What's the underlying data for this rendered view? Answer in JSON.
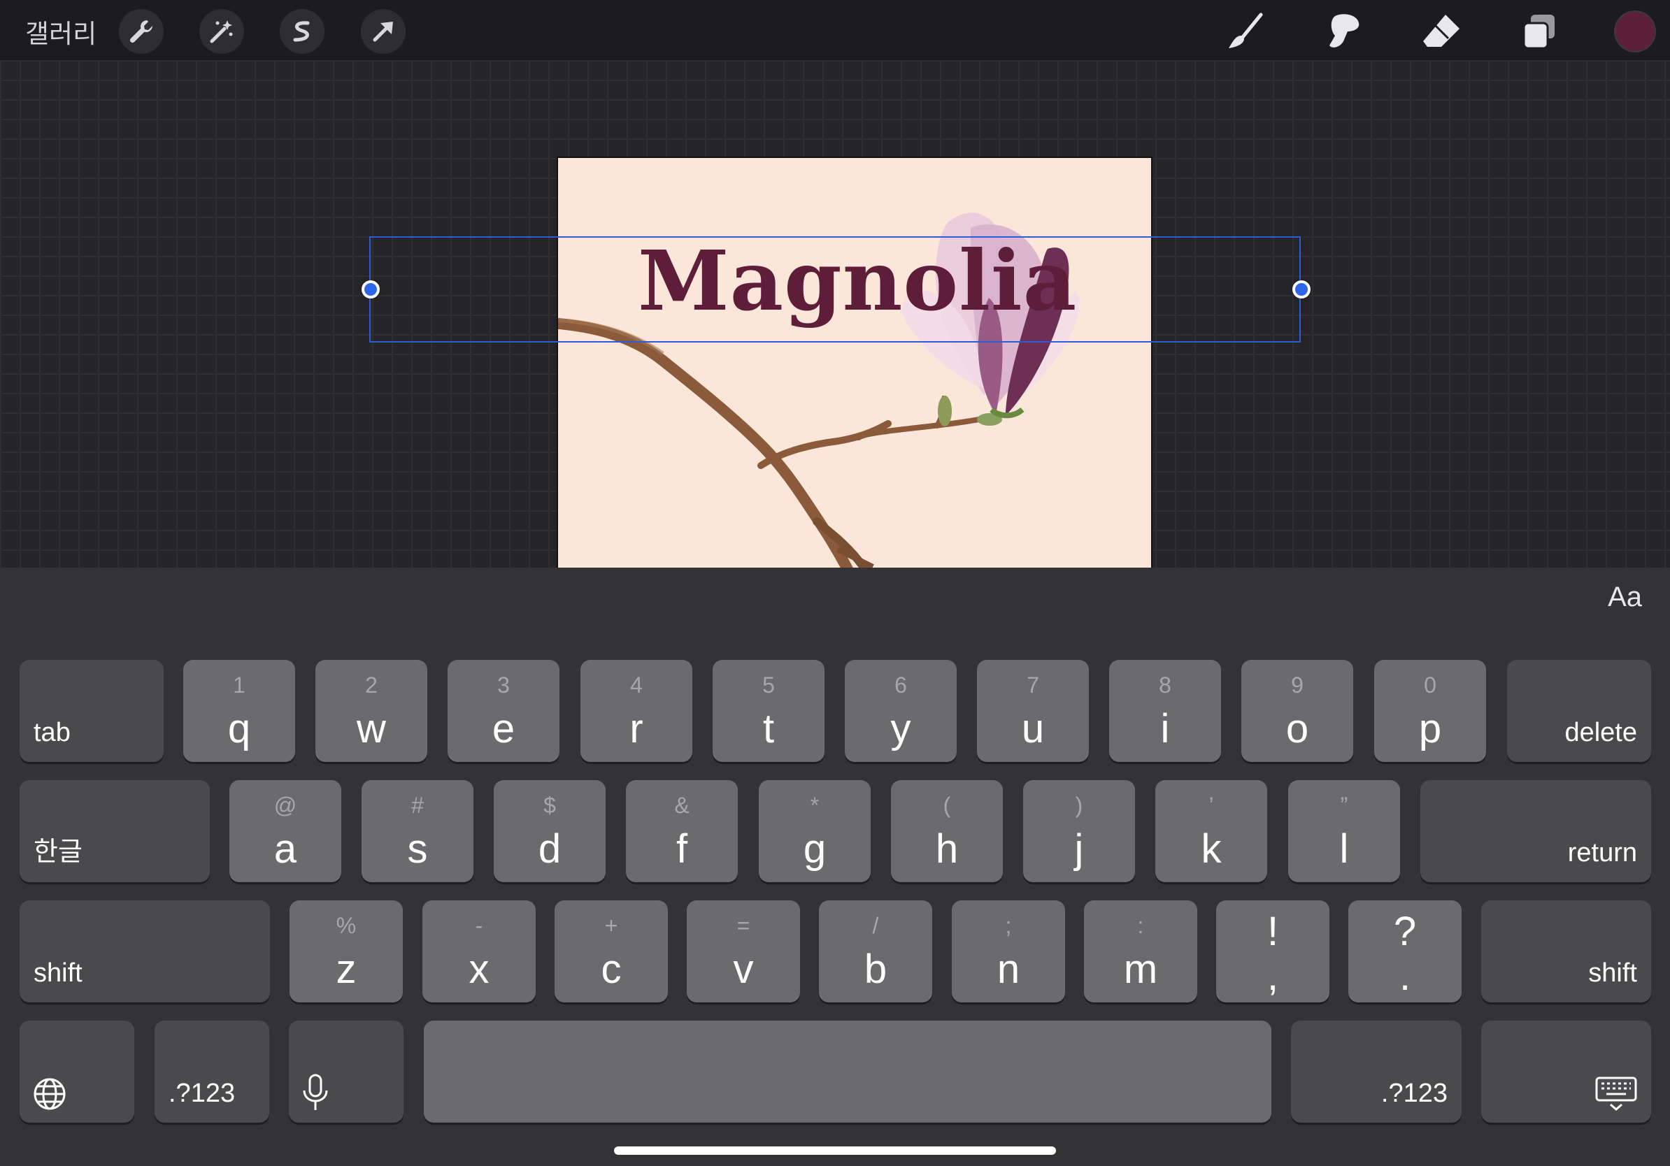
{
  "topbar": {
    "gallery_label": "갤러리",
    "left_tools": [
      "wrench-icon",
      "magic-wand-icon",
      "selection-icon",
      "transform-arrow-icon"
    ],
    "right_tools": [
      "brush-icon",
      "smudge-icon",
      "eraser-icon",
      "layers-icon"
    ],
    "current_color": "#5c2038"
  },
  "canvas": {
    "text": "Magnolia",
    "text_color": "#5e1e3a",
    "background_color": "#fbe7da"
  },
  "keyboard": {
    "aa_label": "Aa",
    "row1": {
      "tab": "tab",
      "keys": [
        {
          "main": "q",
          "sub": "1"
        },
        {
          "main": "w",
          "sub": "2"
        },
        {
          "main": "e",
          "sub": "3"
        },
        {
          "main": "r",
          "sub": "4"
        },
        {
          "main": "t",
          "sub": "5"
        },
        {
          "main": "y",
          "sub": "6"
        },
        {
          "main": "u",
          "sub": "7"
        },
        {
          "main": "i",
          "sub": "8"
        },
        {
          "main": "o",
          "sub": "9"
        },
        {
          "main": "p",
          "sub": "0"
        }
      ],
      "delete": "delete"
    },
    "row2": {
      "lang": "한글",
      "keys": [
        {
          "main": "a",
          "sub": "@"
        },
        {
          "main": "s",
          "sub": "#"
        },
        {
          "main": "d",
          "sub": "$"
        },
        {
          "main": "f",
          "sub": "&"
        },
        {
          "main": "g",
          "sub": "*"
        },
        {
          "main": "h",
          "sub": "("
        },
        {
          "main": "j",
          "sub": ")"
        },
        {
          "main": "k",
          "sub": "’"
        },
        {
          "main": "l",
          "sub": "”"
        }
      ],
      "return": "return"
    },
    "row3": {
      "shift_left": "shift",
      "keys": [
        {
          "main": "z",
          "sub": "%"
        },
        {
          "main": "x",
          "sub": "-"
        },
        {
          "main": "c",
          "sub": "+"
        },
        {
          "main": "v",
          "sub": "="
        },
        {
          "main": "b",
          "sub": "/"
        },
        {
          "main": "n",
          "sub": ";"
        },
        {
          "main": "m",
          "sub": ":"
        }
      ],
      "punct": [
        {
          "top": "!",
          "bottom": ","
        },
        {
          "top": "?",
          "bottom": "."
        }
      ],
      "shift_right": "shift"
    },
    "row4": {
      "numbers_left": ".?123",
      "numbers_right": ".?123",
      "globe": "globe-icon",
      "mic": "microphone-icon",
      "hide": "keyboard-dismiss-icon"
    }
  }
}
